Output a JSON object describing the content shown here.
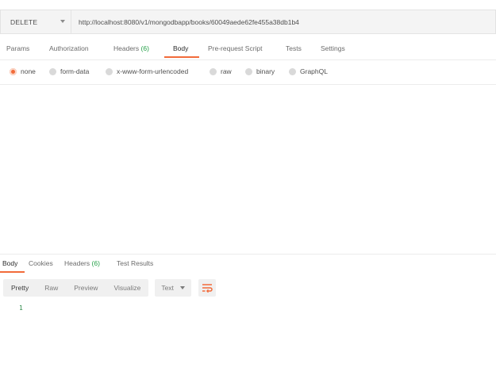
{
  "request": {
    "method": "DELETE",
    "url": "http://localhost:8080/v1/mongodbapp/books/60049aede62fe455a38db1b4"
  },
  "request_tabs": [
    {
      "label": "Params"
    },
    {
      "label": "Authorization"
    },
    {
      "label": "Headers",
      "count": "(6)"
    },
    {
      "label": "Body",
      "active": true
    },
    {
      "label": "Pre-request Script"
    },
    {
      "label": "Tests"
    },
    {
      "label": "Settings"
    }
  ],
  "body_types": [
    {
      "label": "none",
      "selected": true
    },
    {
      "label": "form-data"
    },
    {
      "label": "x-www-form-urlencoded"
    },
    {
      "label": "raw"
    },
    {
      "label": "binary"
    },
    {
      "label": "GraphQL"
    }
  ],
  "response_tabs": [
    {
      "label": "Body",
      "active": true
    },
    {
      "label": "Cookies"
    },
    {
      "label": "Headers",
      "count": "(6)"
    },
    {
      "label": "Test Results"
    }
  ],
  "response_view": {
    "modes": [
      "Pretty",
      "Raw",
      "Preview",
      "Visualize"
    ],
    "active_mode": "Pretty",
    "format": "Text",
    "line_number": "1"
  },
  "colors": {
    "accent": "#f26b3a",
    "count_green": "#23a047"
  },
  "icons": {
    "method_dropdown": "chevron-down-icon",
    "format_dropdown": "chevron-down-icon",
    "wrap": "word-wrap-icon"
  }
}
